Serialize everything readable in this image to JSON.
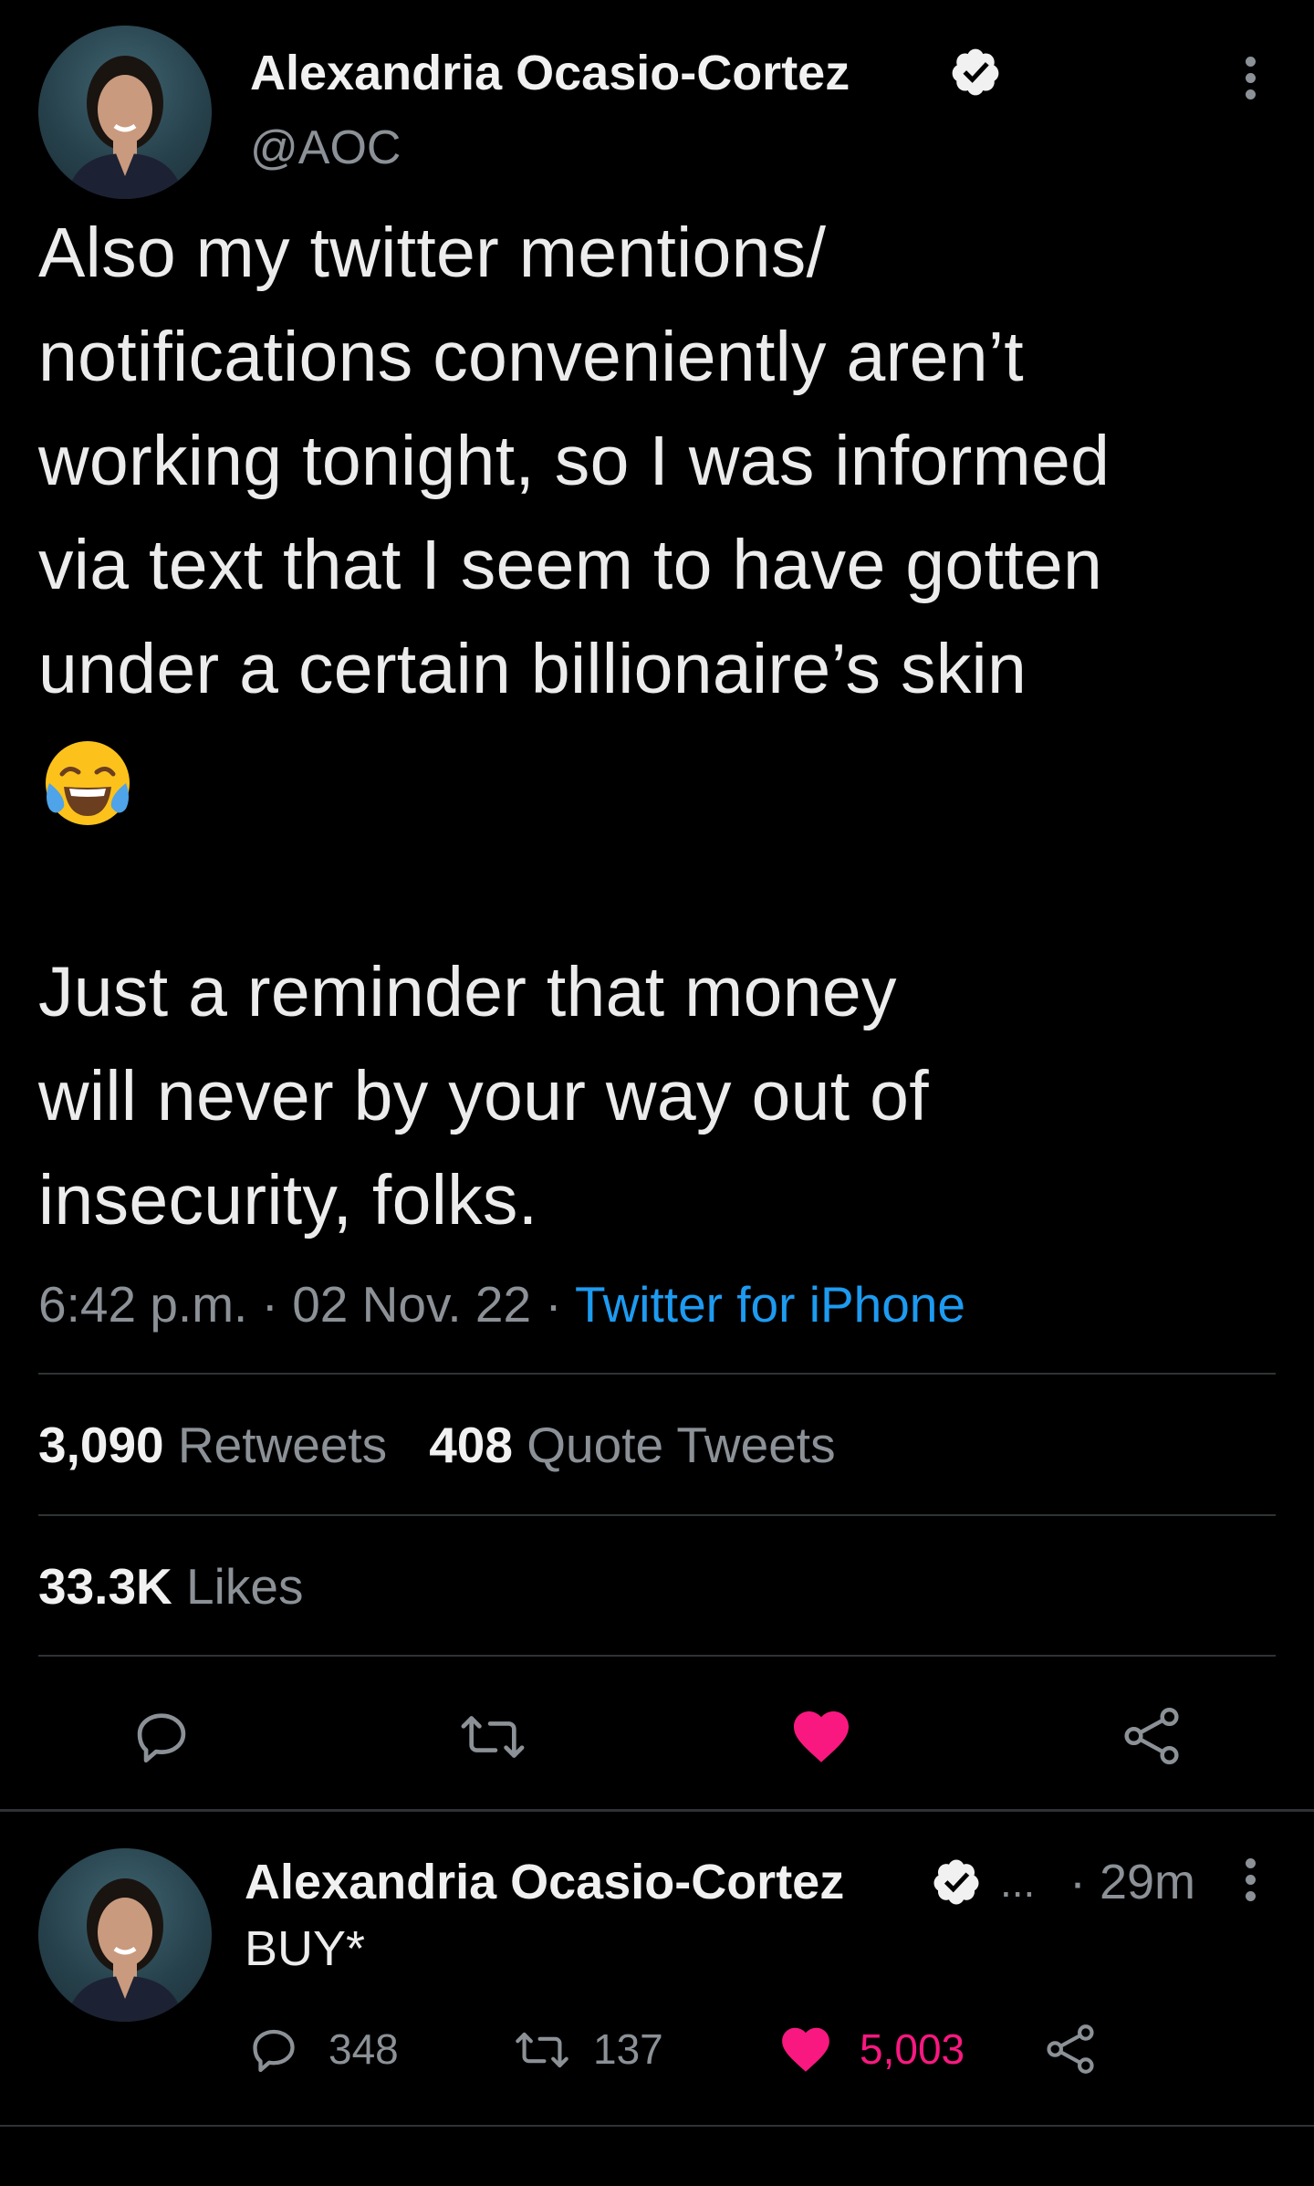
{
  "tweet": {
    "author_name": "Alexandria Ocasio-Cortez",
    "handle": "@AOC",
    "verified": true,
    "text_lines": [
      "Also my twitter mentions/",
      "notifications conveniently aren’t",
      "working tonight, so I was informed",
      "via text that I seem to have gotten",
      "under a certain billionaire’s skin"
    ],
    "emoji": "😂",
    "text_lines_2": [
      "Just a reminder that money",
      "will never by your way out of",
      "insecurity, folks."
    ],
    "time": "6:42 p.m.",
    "date": "02 Nov. 22",
    "separator": "·",
    "source": "Twitter for iPhone",
    "retweets_count": "3,090",
    "retweets_label": "Retweets",
    "quote_tweets_count": "408",
    "quote_tweets_label": "Quote Tweets",
    "likes_count": "33.3K",
    "likes_label": "Likes",
    "actions": [
      "reply-icon",
      "retweet-icon",
      "like-icon-filled",
      "share-icon"
    ]
  },
  "reply": {
    "author_name": "Alexandria Ocasio-Cortez",
    "verified": true,
    "ellipsis": "...",
    "time": "· 29m",
    "text": "BUY*",
    "reply_count": "348",
    "retweet_count": "137",
    "like_count": "5,003"
  },
  "colors": {
    "background": "#000000",
    "text": "#e7e9ea",
    "muted": "#8b9196",
    "link": "#1d9bf0",
    "like": "#f91880",
    "divider": "#2f3336"
  }
}
